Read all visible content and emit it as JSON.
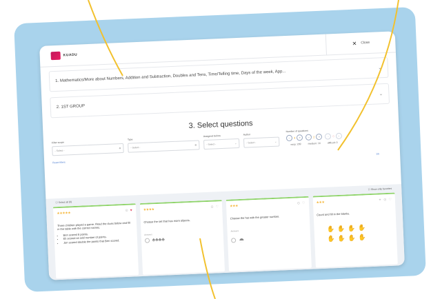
{
  "app": {
    "brand": "KUADU"
  },
  "header": {
    "close_label": "Close",
    "close_icon": "close-icon"
  },
  "accordions": [
    {
      "label": "1. Mathematics/More about Numbers, Addition and Subtraction, Doubles and Tens, Time/Telling time, Days of the week, App..."
    },
    {
      "label": "2. 1ST GROUP"
    }
  ],
  "section": {
    "title": "3. Select questions"
  },
  "filters": {
    "filter_scope": {
      "label": "Filter scope",
      "value": "- Select -"
    },
    "type": {
      "label": "Type",
      "value": "- Select -"
    },
    "assigned_before": {
      "label": "Assigned before",
      "value": "- Select -"
    },
    "author": {
      "label": "Author",
      "value": "- Select -"
    },
    "number_of_questions": {
      "label": "Number of questions",
      "easy_value": "4",
      "medium_value": "2",
      "difficult_value": "0",
      "easy_label": "easy: 209",
      "medium_label": "medium: 16",
      "difficult_label": "difficult: 0"
    },
    "counter": "1/5",
    "reset_label": "Reset filters"
  },
  "cards_area": {
    "select_all_label": "Select all (6)",
    "favorites_label": "Show only favorites",
    "cards": [
      {
        "stars": "★★★★★",
        "text": "Three children played a game. Read the clues below and fill in the table with the correct names.",
        "bullets": [
          "Ben scored 8 points.",
          "Eli scored an odd number of points.",
          "Jon scored double the points that Ben scored."
        ]
      },
      {
        "stars": "★★★★",
        "text": "Choose the set that has more objects.",
        "answers_label": "Answers",
        "answer_glyphs": "♣♣♣♣"
      },
      {
        "stars": "★★★",
        "text": "Choose the hat with the greater number.",
        "answers_label": "Answers",
        "answer_glyphs": "◓"
      },
      {
        "stars": "★★★",
        "text": "Count and fill in the blanks.",
        "answer_glyphs": "✋"
      }
    ]
  },
  "colors": {
    "backdrop": "#a9d3ec",
    "card_top": "#8fd46a",
    "star": "#f5b73b",
    "callout_line": "#f2c12e",
    "brand": "#e91e63"
  }
}
